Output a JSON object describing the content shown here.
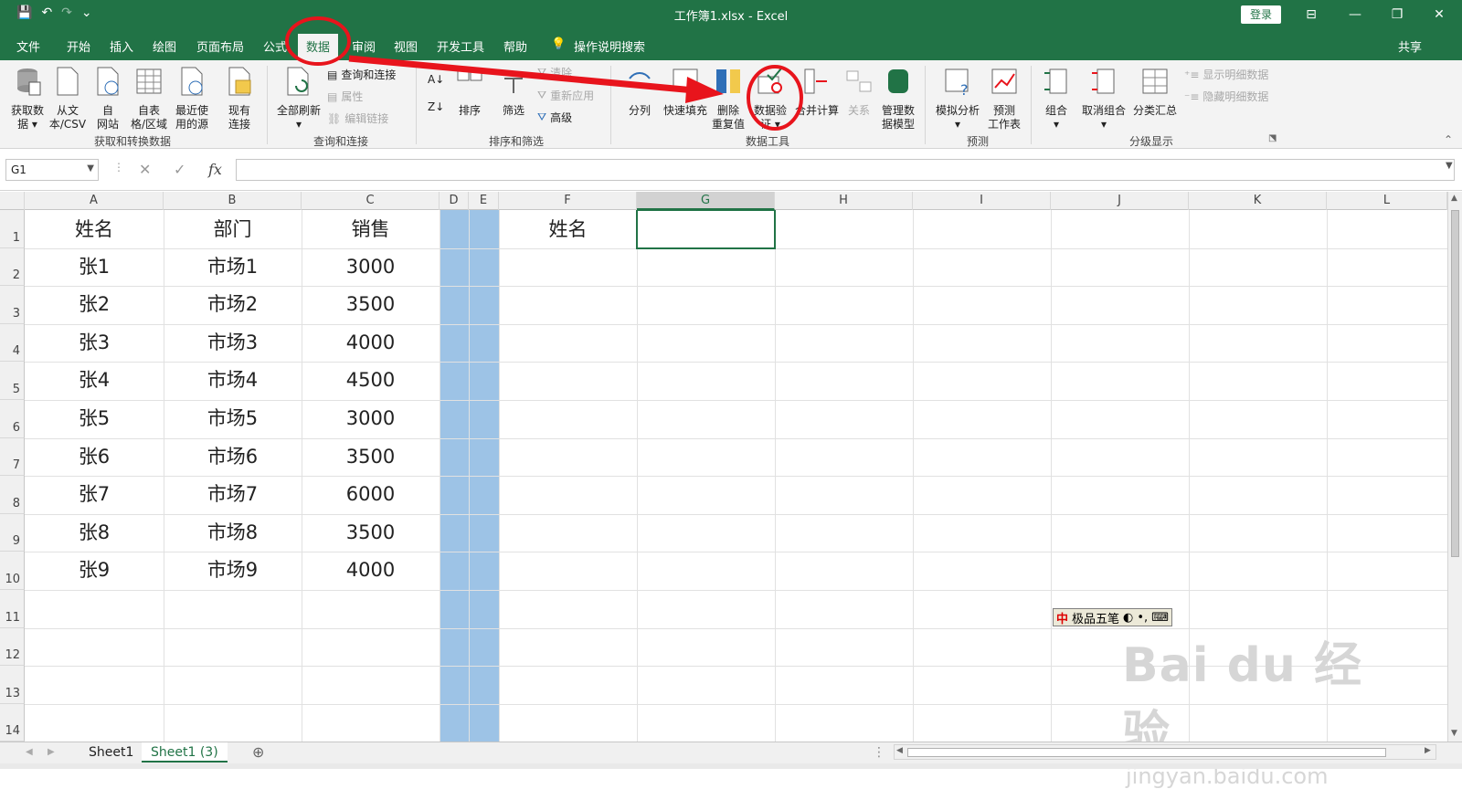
{
  "titlebar": {
    "title": "工作簿1.xlsx  -  Excel",
    "login_label": "登录",
    "save_icon": "💾",
    "undo_icon": "↶",
    "redo_icon": "↷",
    "customize_icon": "⌄",
    "ribbon_display_icon": "⊟",
    "minimize_icon": "—",
    "restore_icon": "❐",
    "close_icon": "✕"
  },
  "menu": {
    "tabs": [
      "文件",
      "开始",
      "插入",
      "绘图",
      "页面布局",
      "公式",
      "数据",
      "审阅",
      "视图",
      "开发工具",
      "帮助"
    ],
    "active_tab": "数据",
    "search_label": "操作说明搜索",
    "share_label": "共享"
  },
  "ribbon": {
    "get_data": "获取数\n据 ▾",
    "from_text": "从文\n本/CSV",
    "from_web": "自\n网站",
    "from_table": "自表\n格/区域",
    "recent_sources": "最近使\n用的源",
    "existing_connections": "现有\n连接",
    "group_get": "获取和转换数据",
    "refresh_all": "全部刷新\n▾",
    "queries_connections": "查询和连接",
    "properties": "属性",
    "edit_links": "编辑链接",
    "group_query": "查询和连接",
    "sort": "排序",
    "filter": "筛选",
    "clear": "清除",
    "reapply": "重新应用",
    "advanced": "高级",
    "group_sort": "排序和筛选",
    "text_to_columns": "分列",
    "flash_fill": "快速填充",
    "remove_duplicates": "删除\n重复值",
    "data_validation": "数据验\n证 ▾",
    "consolidate": "合并计算",
    "relationships": "关系",
    "data_model": "管理数\n据模型",
    "group_tools": "数据工具",
    "what_if": "模拟分析\n▾",
    "forecast_sheet": "预测\n工作表",
    "group_forecast": "预测",
    "group_btn": "组合\n▾",
    "ungroup": "取消组合\n▾",
    "subtotal": "分类汇总",
    "show_detail": "显示明细数据",
    "hide_detail": "隐藏明细数据",
    "group_outline": "分级显示"
  },
  "formula_bar": {
    "name_box": "G1",
    "cancel_icon": "✕",
    "enter_icon": "✓",
    "fx_label": "fx",
    "formula": ""
  },
  "grid": {
    "columns": [
      "A",
      "B",
      "C",
      "D",
      "E",
      "F",
      "G",
      "H",
      "I",
      "J",
      "K",
      "L"
    ],
    "rows": [
      "1",
      "2",
      "3",
      "4",
      "5",
      "6",
      "7",
      "8",
      "9",
      "10",
      "11",
      "12",
      "13",
      "14"
    ],
    "selected_column": "G",
    "table": [
      [
        "姓名",
        "部门",
        "销售"
      ],
      [
        "张1",
        "市场1",
        "3000"
      ],
      [
        "张2",
        "市场2",
        "3500"
      ],
      [
        "张3",
        "市场3",
        "4000"
      ],
      [
        "张4",
        "市场4",
        "4500"
      ],
      [
        "张5",
        "市场5",
        "3000"
      ],
      [
        "张6",
        "市场6",
        "3500"
      ],
      [
        "张7",
        "市场7",
        "6000"
      ],
      [
        "张8",
        "市场8",
        "3500"
      ],
      [
        "张9",
        "市场9",
        "4000"
      ]
    ],
    "f1": "姓名",
    "highlight_color": "#9dc3e6"
  },
  "ime": {
    "mode": "中",
    "name": "极品五笔",
    "moon_icon": "◐",
    "punct_icon": "•,",
    "keyboard_icon": "⌨"
  },
  "sheets": {
    "tabs": [
      "Sheet1",
      "Sheet1 (3)"
    ],
    "active": "Sheet1 (3)",
    "add_icon": "⊕"
  },
  "watermark": {
    "brand": "Bai  du 经验",
    "url": "jingyan.baidu.com"
  },
  "colors": {
    "excel_green": "#217346",
    "annotation_red": "#e8141c"
  }
}
